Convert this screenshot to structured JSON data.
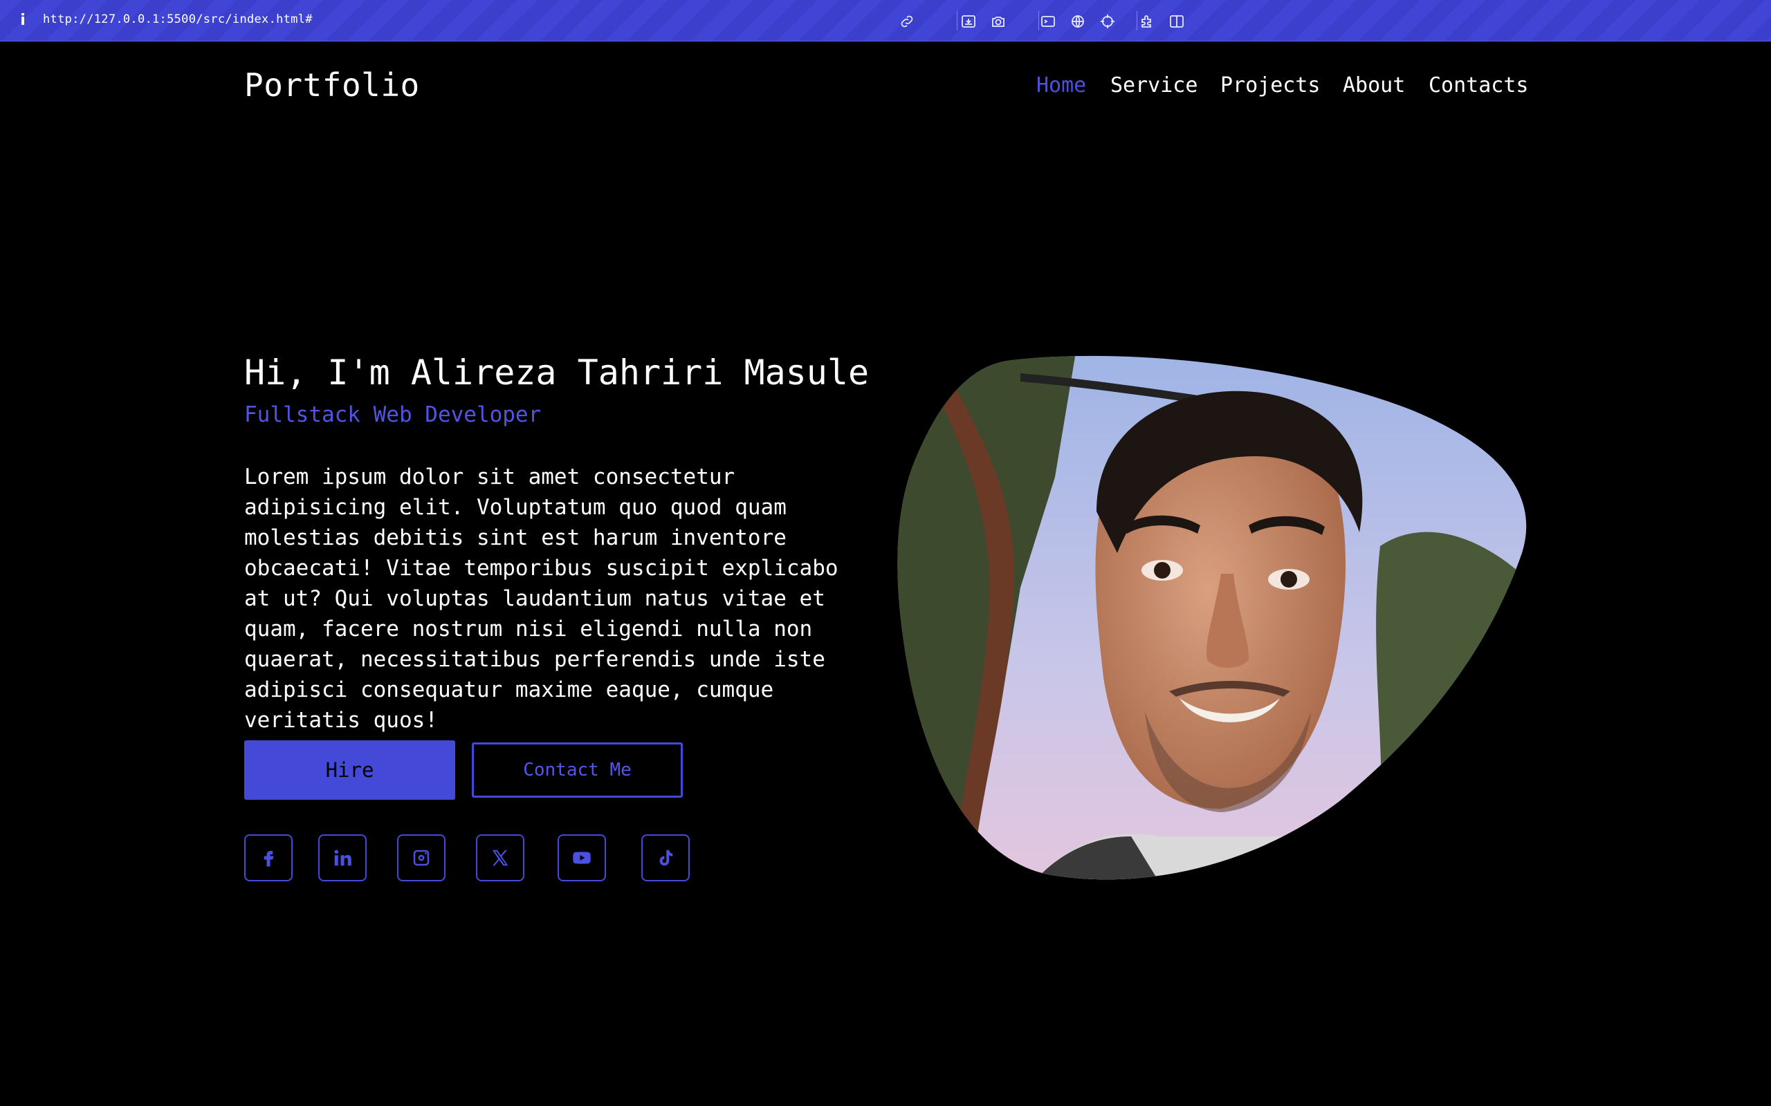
{
  "browser": {
    "url": "http://127.0.0.1:5500/src/index.html#",
    "icons": [
      "info-icon",
      "link-icon",
      "download-icon",
      "camera-icon",
      "terminal-icon",
      "globe-icon",
      "crosshair-icon",
      "extensions-icon",
      "sidebar-icon"
    ]
  },
  "header": {
    "logo": "Portfolio",
    "nav": [
      {
        "label": "Home",
        "active": true
      },
      {
        "label": "Service",
        "active": false
      },
      {
        "label": "Projects",
        "active": false
      },
      {
        "label": "About",
        "active": false
      },
      {
        "label": "Contacts",
        "active": false
      }
    ]
  },
  "hero": {
    "title": "Hi, I'm Alireza Tahriri Masule",
    "subtitle": "Fullstack Web Developer",
    "description": "Lorem ipsum dolor sit amet consectetur adipisicing elit. Voluptatum quo quod quam molestias debitis sint est harum inventore obcaecati! Vitae temporibus suscipit explicabo at ut? Qui voluptas laudantium natus vitae et quam, facere nostrum nisi eligendi nulla non quaerat, necessitatibus perferendis unde iste adipisci consequatur maxime eaque, cumque veritatis quos!",
    "hire_label": "Hire",
    "contact_label": "Contact Me",
    "socials": [
      "facebook-icon",
      "linkedin-icon",
      "instagram-icon",
      "x-icon",
      "youtube-icon",
      "tiktok-icon"
    ]
  },
  "colors": {
    "accent": "#4549d7",
    "background": "#000000",
    "browser_bar": "#4145d6"
  }
}
